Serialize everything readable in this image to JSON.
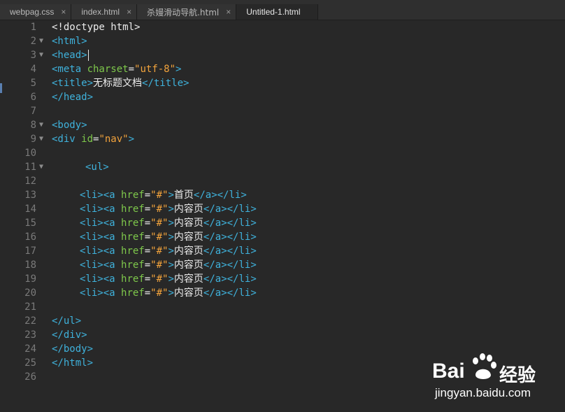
{
  "tabs": [
    {
      "label": "webpag.css",
      "active": false
    },
    {
      "label": "index.html",
      "active": false
    },
    {
      "label": "杀嫚滑动导航.html",
      "active": false
    },
    {
      "label": "Untitled-1.html",
      "active": true
    }
  ],
  "close_glyph": "×",
  "line_numbers": [
    "1",
    "2",
    "3",
    "4",
    "5",
    "6",
    "7",
    "8",
    "9",
    "10",
    "11",
    "12",
    "13",
    "14",
    "15",
    "16",
    "17",
    "18",
    "19",
    "20",
    "21",
    "22",
    "23",
    "24",
    "25",
    "26"
  ],
  "fold_markers_lines": [
    2,
    3,
    8,
    9,
    11
  ],
  "code": {
    "l1": "<!doctype html>",
    "l2": "<html>",
    "l3": "<head>",
    "l4_open": "<meta ",
    "l4_attr": "charset",
    "l4_eq": "=",
    "l4_val": "\"utf-8\"",
    "l4_close": ">",
    "l5_open": "<title>",
    "l5_text": "无标题文档",
    "l5_close": "</title>",
    "l6": "</head>",
    "l8": "<body>",
    "l9_open": "<div ",
    "l9_attr": "id",
    "l9_eq": "=",
    "l9_val": "\"nav\"",
    "l9_close": ">",
    "l11": "<ul>",
    "li_open": "<li><a ",
    "li_attr": "href",
    "li_eq": "=",
    "li_val": "\"#\"",
    "li_gt": ">",
    "li_close": "</a></li>",
    "items": [
      "首页",
      "内容页",
      "内容页",
      "内容页",
      "内容页",
      "内容页",
      "内容页",
      "内容页"
    ],
    "l22": "</ul>",
    "l23": "</div>",
    "l24": "</body>",
    "l25": "</html>"
  },
  "watermark": {
    "brand": "Bai",
    "brand2": "du",
    "suffix": "经验",
    "url": "jingyan.baidu.com"
  }
}
